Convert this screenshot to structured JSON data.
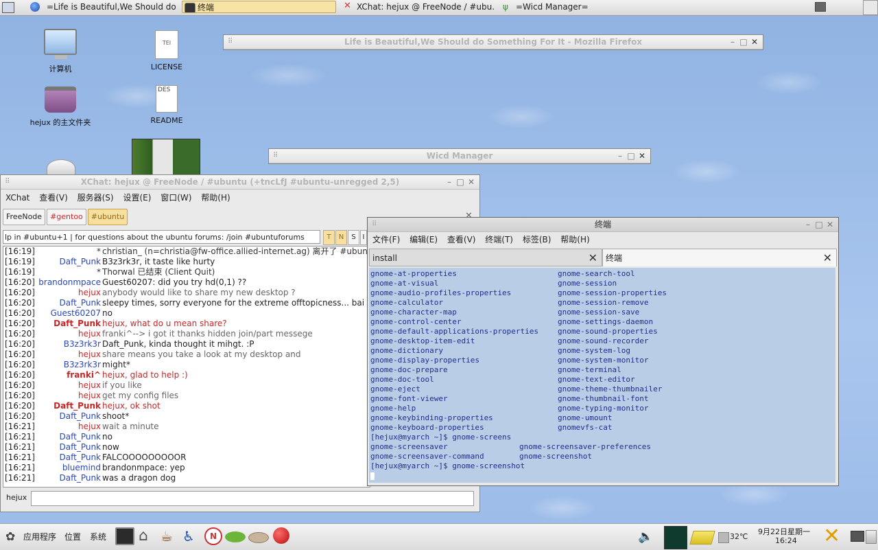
{
  "top_panel": {
    "tasks": [
      {
        "label": "=Life is Beautiful,We Should do S..."
      },
      {
        "label": "终端"
      },
      {
        "label": "XChat: hejux @ FreeNode / #ubu..."
      },
      {
        "label": "=Wicd Manager="
      }
    ]
  },
  "desktop": {
    "icons": [
      {
        "label": "计算机"
      },
      {
        "label": "LICENSE"
      },
      {
        "label": "hejux 的主文件夹"
      },
      {
        "label": "README"
      }
    ],
    "license_glyph": "TEI",
    "readme_glyph": "DES"
  },
  "firefox": {
    "title": "Life is Beautiful,We Should do Something For It - Mozilla Firefox"
  },
  "wicd": {
    "title": "Wicd Manager"
  },
  "xchat": {
    "title": "XChat: hejux @ FreeNode / #ubuntu (+tncLfJ #ubuntu-unregged 2,5)",
    "menu": [
      "XChat",
      "查看(V)",
      "服务器(S)",
      "设置(E)",
      "窗口(W)",
      "帮助(H)"
    ],
    "tabs": [
      "FreeNode",
      "#gentoo",
      "#ubuntu"
    ],
    "topic": "lp in #ubuntu+1 | for questions about the ubuntu forums: /join #ubuntuforums",
    "mode_buttons": [
      "T",
      "N",
      "S",
      "I"
    ],
    "log": [
      {
        "ts": "[16:19]",
        "nick": "*",
        "nick_color": "#333333",
        "msg": "christian_ (n=christia@fw-office.allied-internet.ag) 离开了 #ubuntu",
        "msg_color": "#333333"
      },
      {
        "ts": "[16:19]",
        "nick": "Daft_Punk",
        "nick_color": "#2a47b8",
        "msg": "B3z3rk3r, it taste like hurty",
        "msg_color": "#222222"
      },
      {
        "ts": "[16:19]",
        "nick": "*",
        "nick_color": "#333333",
        "msg": "Thorwal 已结束 (Client Quit)",
        "msg_color": "#333333"
      },
      {
        "ts": "[16:20]",
        "nick": "brandonmpace",
        "nick_color": "#2a47b8",
        "msg": "Guest60207: did you try hd(0,1)     ??",
        "msg_color": "#222222"
      },
      {
        "ts": "[16:20]",
        "nick": "hejux",
        "nick_color": "#c62828",
        "msg": "anybody would like to share my new desktop ?",
        "msg_color": "#666666"
      },
      {
        "ts": "[16:20]",
        "nick": "Daft_Punk",
        "nick_color": "#2a47b8",
        "msg": "sleepy times, sorry everyone for the extreme offtopicness... bai",
        "msg_color": "#222222"
      },
      {
        "ts": "[16:20]",
        "nick": "Guest60207",
        "nick_color": "#2a47b8",
        "msg": "no",
        "msg_color": "#222222"
      },
      {
        "ts": "[16:20]",
        "nick": "Daft_Punk",
        "nick_color": "#c62828",
        "msg": "hejux, what do u mean share?",
        "msg_color": "#c62828",
        "bold": true
      },
      {
        "ts": "[16:20]",
        "nick": "hejux",
        "nick_color": "#c62828",
        "msg": "franki^--> i got it thanks  hidden join/part messege",
        "msg_color": "#666666"
      },
      {
        "ts": "[16:20]",
        "nick": "B3z3rk3r",
        "nick_color": "#2a47b8",
        "msg": "Daft_Punk, kinda thought it mihgt. :P",
        "msg_color": "#222222"
      },
      {
        "ts": "[16:20]",
        "nick": "hejux",
        "nick_color": "#c62828",
        "msg": "share means you take a look at my desktop and",
        "msg_color": "#666666"
      },
      {
        "ts": "[16:20]",
        "nick": "B3z3rk3r",
        "nick_color": "#2a47b8",
        "msg": "might*",
        "msg_color": "#222222"
      },
      {
        "ts": "[16:20]",
        "nick": "franki^",
        "nick_color": "#c62828",
        "msg": "hejux, glad to help :)",
        "msg_color": "#c62828",
        "bold": true
      },
      {
        "ts": "[16:20]",
        "nick": "hejux",
        "nick_color": "#c62828",
        "msg": "if you like",
        "msg_color": "#666666"
      },
      {
        "ts": "[16:20]",
        "nick": "hejux",
        "nick_color": "#c62828",
        "msg": "get my config files",
        "msg_color": "#666666"
      },
      {
        "ts": "[16:20]",
        "nick": "Daft_Punk",
        "nick_color": "#c62828",
        "msg": "hejux, ok shot",
        "msg_color": "#c62828",
        "bold": true
      },
      {
        "ts": "[16:20]",
        "nick": "Daft_Punk",
        "nick_color": "#2a47b8",
        "msg": "shoot*",
        "msg_color": "#222222"
      },
      {
        "ts": "[16:21]",
        "nick": "hejux",
        "nick_color": "#c62828",
        "msg": "wait a minute",
        "msg_color": "#666666"
      },
      {
        "ts": "[16:21]",
        "nick": "Daft_Punk",
        "nick_color": "#2a47b8",
        "msg": "no",
        "msg_color": "#222222"
      },
      {
        "ts": "[16:21]",
        "nick": "Daft_Punk",
        "nick_color": "#2a47b8",
        "msg": "now",
        "msg_color": "#222222"
      },
      {
        "ts": "[16:21]",
        "nick": "Daft_Punk",
        "nick_color": "#2a47b8",
        "msg": "FALCOOOOOOOOOR",
        "msg_color": "#222222"
      },
      {
        "ts": "[16:21]",
        "nick": "bluemind",
        "nick_color": "#2a47b8",
        "msg": "brandonmpace: yep",
        "msg_color": "#222222"
      },
      {
        "ts": "[16:21]",
        "nick": "Daft_Punk",
        "nick_color": "#2a47b8",
        "msg": "was a dragon dog",
        "msg_color": "#222222"
      }
    ],
    "nick": "hejux",
    "input_value": ""
  },
  "terminal": {
    "title": "终端",
    "menu": [
      "文件(F)",
      "编辑(E)",
      "查看(V)",
      "终端(T)",
      "标签(B)",
      "帮助(H)"
    ],
    "tabs": [
      "install",
      "终端"
    ],
    "completions_left": [
      "gnome-at-properties",
      "gnome-at-visual",
      "gnome-audio-profiles-properties",
      "gnome-calculator",
      "gnome-character-map",
      "gnome-control-center",
      "gnome-default-applications-properties",
      "gnome-desktop-item-edit",
      "gnome-dictionary",
      "gnome-display-properties",
      "gnome-doc-prepare",
      "gnome-doc-tool",
      "gnome-eject",
      "gnome-font-viewer",
      "gnome-help",
      "gnome-keybinding-properties",
      "gnome-keyboard-properties"
    ],
    "completions_right": [
      "gnome-search-tool",
      "gnome-session",
      "gnome-session-properties",
      "gnome-session-remove",
      "gnome-session-save",
      "gnome-settings-daemon",
      "gnome-sound-properties",
      "gnome-sound-recorder",
      "gnome-system-log",
      "gnome-system-monitor",
      "gnome-terminal",
      "gnome-text-editor",
      "gnome-theme-thumbnailer",
      "gnome-thumbnail-font",
      "gnome-typing-monitor",
      "gnome-umount",
      "gnomevfs-cat"
    ],
    "prompt1": "[hejux@myarch ~]$ gnome-screens",
    "screens_left": [
      "gnome-screensaver",
      "gnome-screensaver-command"
    ],
    "screens_right": [
      "gnome-screensaver-preferences",
      "gnome-screenshot"
    ],
    "prompt2": "[hejux@myarch ~]$ gnome-screenshot"
  },
  "bottom_panel": {
    "menus": [
      "应用程序",
      "位置",
      "系统"
    ],
    "temperature": "32℃",
    "date": "9月22日星期一",
    "time": "16:24"
  }
}
